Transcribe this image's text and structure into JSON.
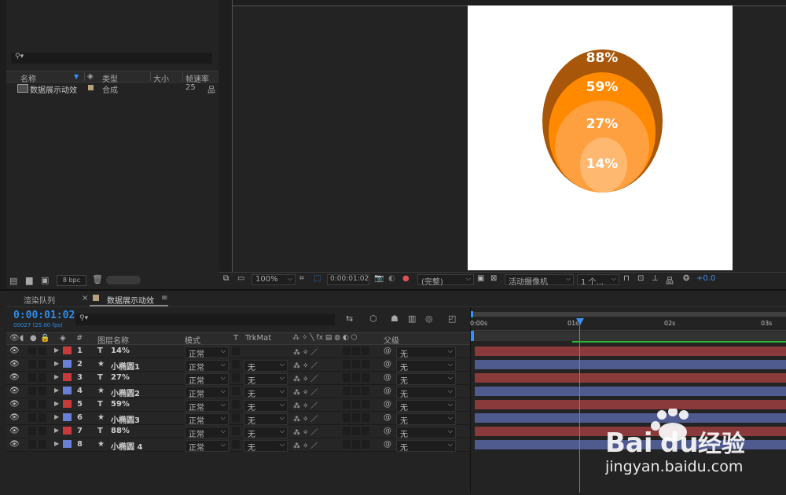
{
  "project": {
    "search_icon": "search-icon",
    "columns": {
      "name": "名称",
      "type": "类型",
      "size": "大小",
      "fps": "帧速率"
    },
    "item": {
      "name": "数据展示动效",
      "type": "合成",
      "fps": "25"
    },
    "bpc": "8 bpc"
  },
  "viewer": {
    "circles": [
      {
        "label": "88%",
        "color": "#a8560a"
      },
      {
        "label": "59%",
        "color": "#ff8a00"
      },
      {
        "label": "27%",
        "color": "#ffa040"
      },
      {
        "label": "14%",
        "color": "#ffb870"
      }
    ],
    "toolbar": {
      "zoom": "100%",
      "timecode": "0:00:01:02",
      "resolution": "(完整)",
      "camera": "活动摄像机",
      "views": "1 个...",
      "exposure": "+0.0"
    }
  },
  "timeline": {
    "tabs": {
      "render_queue": "渲染队列",
      "comp": "数据展示动效"
    },
    "timecode": "0:00:01:02",
    "frame_info": "00027 (25.00 fps)",
    "columns": {
      "num": "#",
      "layer_name": "图层名称",
      "mode": "模式",
      "t": "T",
      "trkmat": "TrkMat",
      "parent": "父级"
    },
    "ruler": {
      "t0": "0:00s",
      "t1": "01s",
      "t2": "02s",
      "t3": "03s"
    },
    "layers": [
      {
        "num": "1",
        "icon": "T",
        "name": "14%",
        "mode": "正常",
        "trkmat": "",
        "parent": "无",
        "label": "#c93a3a"
      },
      {
        "num": "2",
        "icon": "★",
        "name": "小椭圆1",
        "mode": "正常",
        "trkmat": "无",
        "parent": "无",
        "label": "#6a7fd6"
      },
      {
        "num": "3",
        "icon": "T",
        "name": "27%",
        "mode": "正常",
        "trkmat": "无",
        "parent": "无",
        "label": "#c93a3a"
      },
      {
        "num": "4",
        "icon": "★",
        "name": "小椭圆2",
        "mode": "正常",
        "trkmat": "无",
        "parent": "无",
        "label": "#6a7fd6"
      },
      {
        "num": "5",
        "icon": "T",
        "name": "59%",
        "mode": "正常",
        "trkmat": "无",
        "parent": "无",
        "label": "#c93a3a"
      },
      {
        "num": "6",
        "icon": "★",
        "name": "小椭圆3",
        "mode": "正常",
        "trkmat": "无",
        "parent": "无",
        "label": "#6a7fd6"
      },
      {
        "num": "7",
        "icon": "T",
        "name": "88%",
        "mode": "正常",
        "trkmat": "无",
        "parent": "无",
        "label": "#c93a3a"
      },
      {
        "num": "8",
        "icon": "★",
        "name": "小椭圆 4",
        "mode": "正常",
        "trkmat": "无",
        "parent": "无",
        "label": "#6a7fd6"
      }
    ],
    "bar_colors": {
      "text": "#8a3a3a",
      "shape": "#4f5a8e"
    }
  },
  "watermark": {
    "brand": "Bai",
    "du": "du",
    "cn": "经验",
    "url": "jingyan.baidu.com"
  }
}
